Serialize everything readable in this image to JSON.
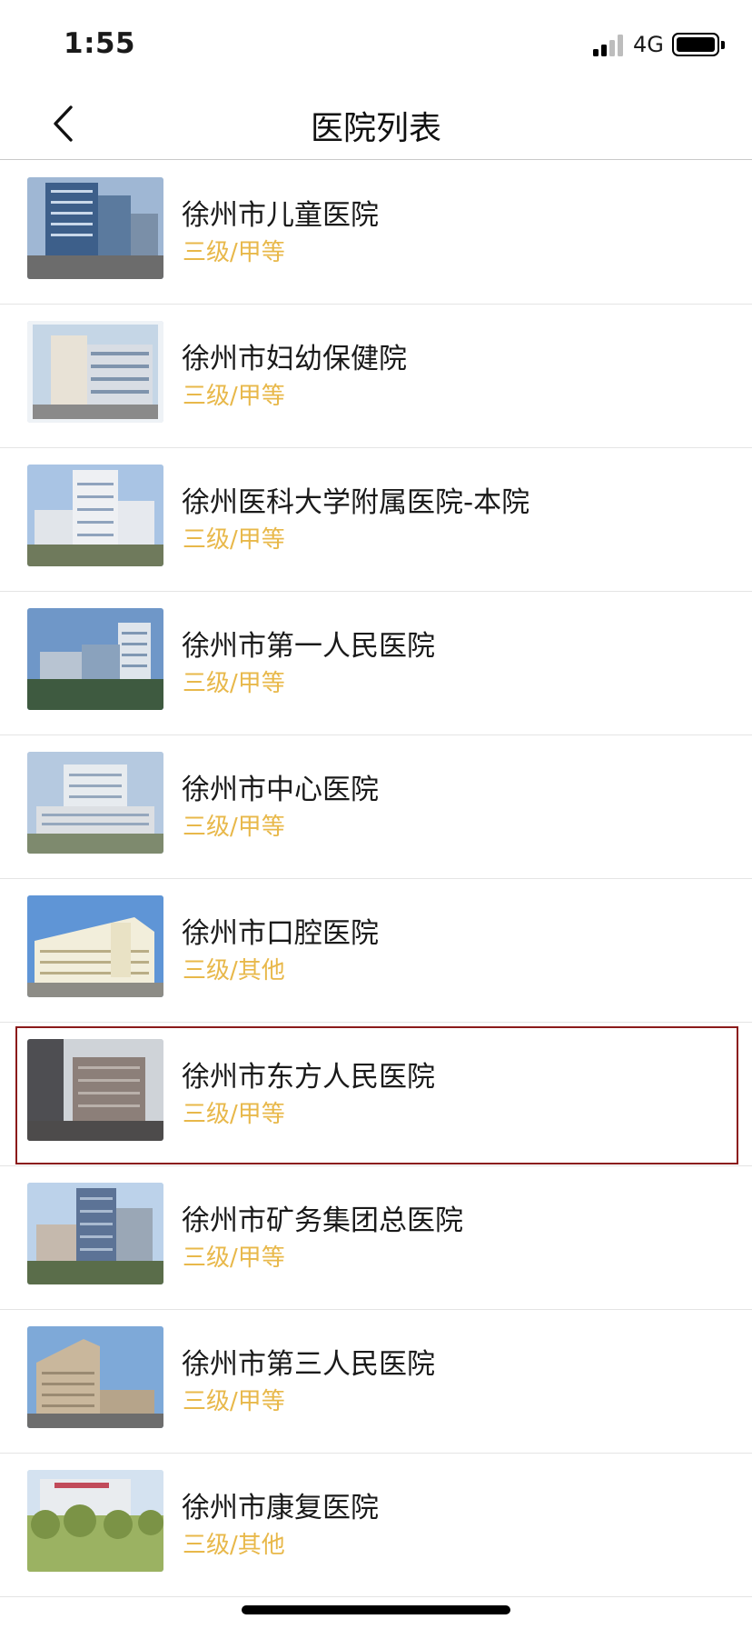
{
  "status_bar": {
    "time": "1:55",
    "network": "4G"
  },
  "nav": {
    "title": "医院列表"
  },
  "colors": {
    "level_text": "#e8b84a",
    "selected_border": "#8b1a1a"
  },
  "hospitals": [
    {
      "name": "徐州市儿童医院",
      "level": "三级/甲等",
      "selected": false
    },
    {
      "name": "徐州市妇幼保健院",
      "level": "三级/甲等",
      "selected": false
    },
    {
      "name": "徐州医科大学附属医院-本院",
      "level": "三级/甲等",
      "selected": false
    },
    {
      "name": "徐州市第一人民医院",
      "level": "三级/甲等",
      "selected": false
    },
    {
      "name": "徐州市中心医院",
      "level": "三级/甲等",
      "selected": false
    },
    {
      "name": "徐州市口腔医院",
      "level": "三级/其他",
      "selected": false
    },
    {
      "name": "徐州市东方人民医院",
      "level": "三级/甲等",
      "selected": true
    },
    {
      "name": "徐州市矿务集团总医院",
      "level": "三级/甲等",
      "selected": false
    },
    {
      "name": "徐州市第三人民医院",
      "level": "三级/甲等",
      "selected": false
    },
    {
      "name": "徐州市康复医院",
      "level": "三级/其他",
      "selected": false
    }
  ]
}
